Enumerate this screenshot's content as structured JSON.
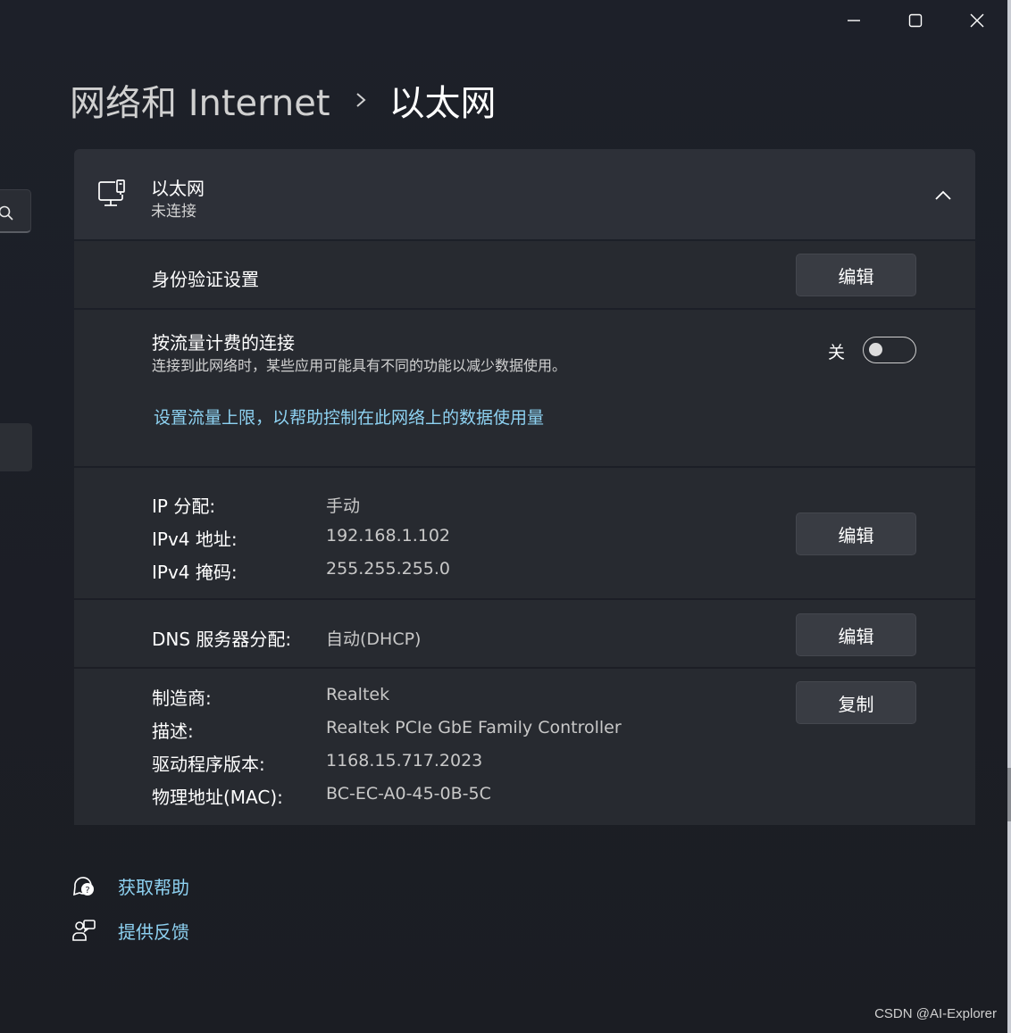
{
  "titlebar": {
    "minimize_icon": "minimize-icon",
    "maximize_icon": "maximize-icon",
    "close_icon": "close-icon"
  },
  "breadcrumb": {
    "parent": "网络和 Internet",
    "separator_icon": "chevron-right-icon",
    "current": "以太网"
  },
  "adapter": {
    "icon": "ethernet-monitor-icon",
    "name": "以太网",
    "status": "未连接",
    "collapse_icon": "chevron-up-icon"
  },
  "auth": {
    "label": "身份验证设置",
    "button": "编辑"
  },
  "metered": {
    "label": "按流量计费的连接",
    "description": "连接到此网络时，某些应用可能具有不同的功能以减少数据使用。",
    "toggle_state": "关",
    "toggle_on": false,
    "link": "设置流量上限，以帮助控制在此网络上的数据使用量"
  },
  "ip": {
    "rows": [
      {
        "label": "IP 分配:",
        "value": "手动"
      },
      {
        "label": "IPv4 地址:",
        "value": "192.168.1.102"
      },
      {
        "label": "IPv4 掩码:",
        "value": "255.255.255.0"
      }
    ],
    "button": "编辑"
  },
  "dns": {
    "label": "DNS 服务器分配:",
    "value": "自动(DHCP)",
    "button": "编辑"
  },
  "properties": {
    "rows": [
      {
        "label": "制造商:",
        "value": "Realtek"
      },
      {
        "label": "描述:",
        "value": "Realtek PCIe GbE Family Controller"
      },
      {
        "label": "驱动程序版本:",
        "value": "1168.15.717.2023"
      },
      {
        "label": "物理地址(MAC):",
        "value": "BC-EC-A0-45-0B-5C"
      }
    ],
    "button": "复制"
  },
  "help": {
    "get_help": "获取帮助",
    "get_help_icon": "help-chat-icon",
    "feedback": "提供反馈",
    "feedback_icon": "feedback-person-icon"
  },
  "watermark": "CSDN @AI-Explorer"
}
